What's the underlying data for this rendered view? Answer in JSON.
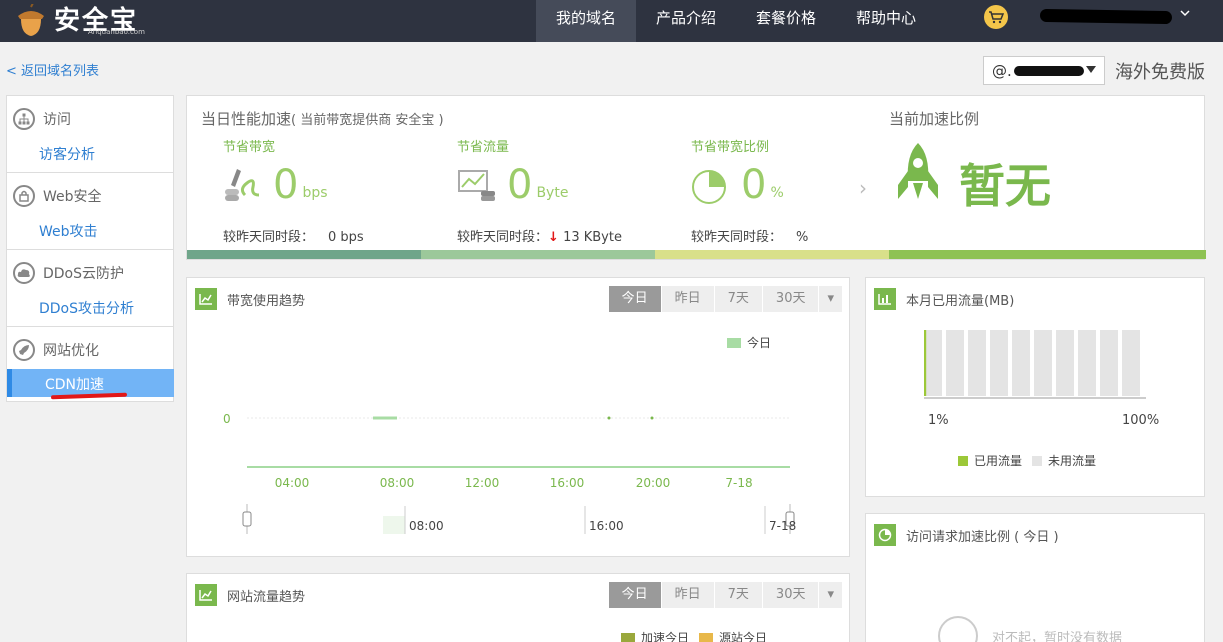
{
  "brand": {
    "name": "安全宝",
    "sub": "Anquanbao.com"
  },
  "nav": {
    "items": [
      "我的域名",
      "产品介绍",
      "套餐价格",
      "帮助中心"
    ],
    "active": 0
  },
  "back_link": "< 返回域名列表",
  "domain_select": {
    "prefix": "@."
  },
  "region_label": "海外免费版",
  "sidebar": {
    "sections": [
      {
        "title": "访问",
        "link": "访客分析",
        "icon": "sitemap-icon"
      },
      {
        "title": "Web安全",
        "link": "Web攻击",
        "icon": "lock-icon"
      },
      {
        "title": "DDoS云防护",
        "link": "DDoS攻击分析",
        "icon": "cloud-icon"
      },
      {
        "title": "网站优化",
        "link": "CDN加速",
        "icon": "rocket-icon"
      }
    ]
  },
  "perf": {
    "title": "当日性能加速",
    "subtitle": "( 当前带宽提供商 安全宝 )",
    "metrics": [
      {
        "label": "节省带宽",
        "value": "0",
        "unit": "bps",
        "cmp_label": "较昨天同时段：",
        "cmp_value": "0 bps",
        "arrow": ""
      },
      {
        "label": "节省流量",
        "value": "0",
        "unit": "Byte",
        "cmp_label": "较昨天同时段：",
        "cmp_value": "13 KByte",
        "arrow": "↓"
      },
      {
        "label": "节省带宽比例",
        "value": "0",
        "unit": "%",
        "cmp_label": "较昨天同时段：",
        "cmp_value": "%",
        "arrow": ""
      }
    ],
    "accel_title": "当前加速比例",
    "accel_value": "暂无",
    "stripe_colors": [
      "#6fa58a",
      "#9cc89a",
      "#d9e08a",
      "#8ec253"
    ]
  },
  "bandwidth_chart": {
    "title": "带宽使用趋势",
    "tabs": [
      "今日",
      "昨日",
      "7天",
      "30天"
    ],
    "legend": "今日",
    "y_tick": "0",
    "x_ticks": [
      "04:00",
      "08:00",
      "12:00",
      "16:00",
      "20:00",
      "7-18"
    ],
    "nav_ticks": [
      "08:00",
      "16:00",
      "7-18"
    ],
    "color": "#a8dca4"
  },
  "monthly_traffic": {
    "title": "本月已用流量(MB)",
    "used_fraction": 0.01,
    "low_label": "1%",
    "high_label": "100%",
    "legend_used": "已用流量",
    "legend_unused": "未用流量",
    "used_color": "#9cc838",
    "unused_color": "#e4e4e4"
  },
  "site_traffic_chart": {
    "title": "网站流量趋势",
    "tabs": [
      "今日",
      "昨日",
      "7天",
      "30天"
    ],
    "legend": [
      "加速今日",
      "源站今日"
    ],
    "legend_colors": [
      "#9aa83c",
      "#e8b84a"
    ]
  },
  "accel_ratio": {
    "title": "访问请求加速比例 ( 今日 )",
    "no_data": "对不起，暂时没有数据"
  }
}
